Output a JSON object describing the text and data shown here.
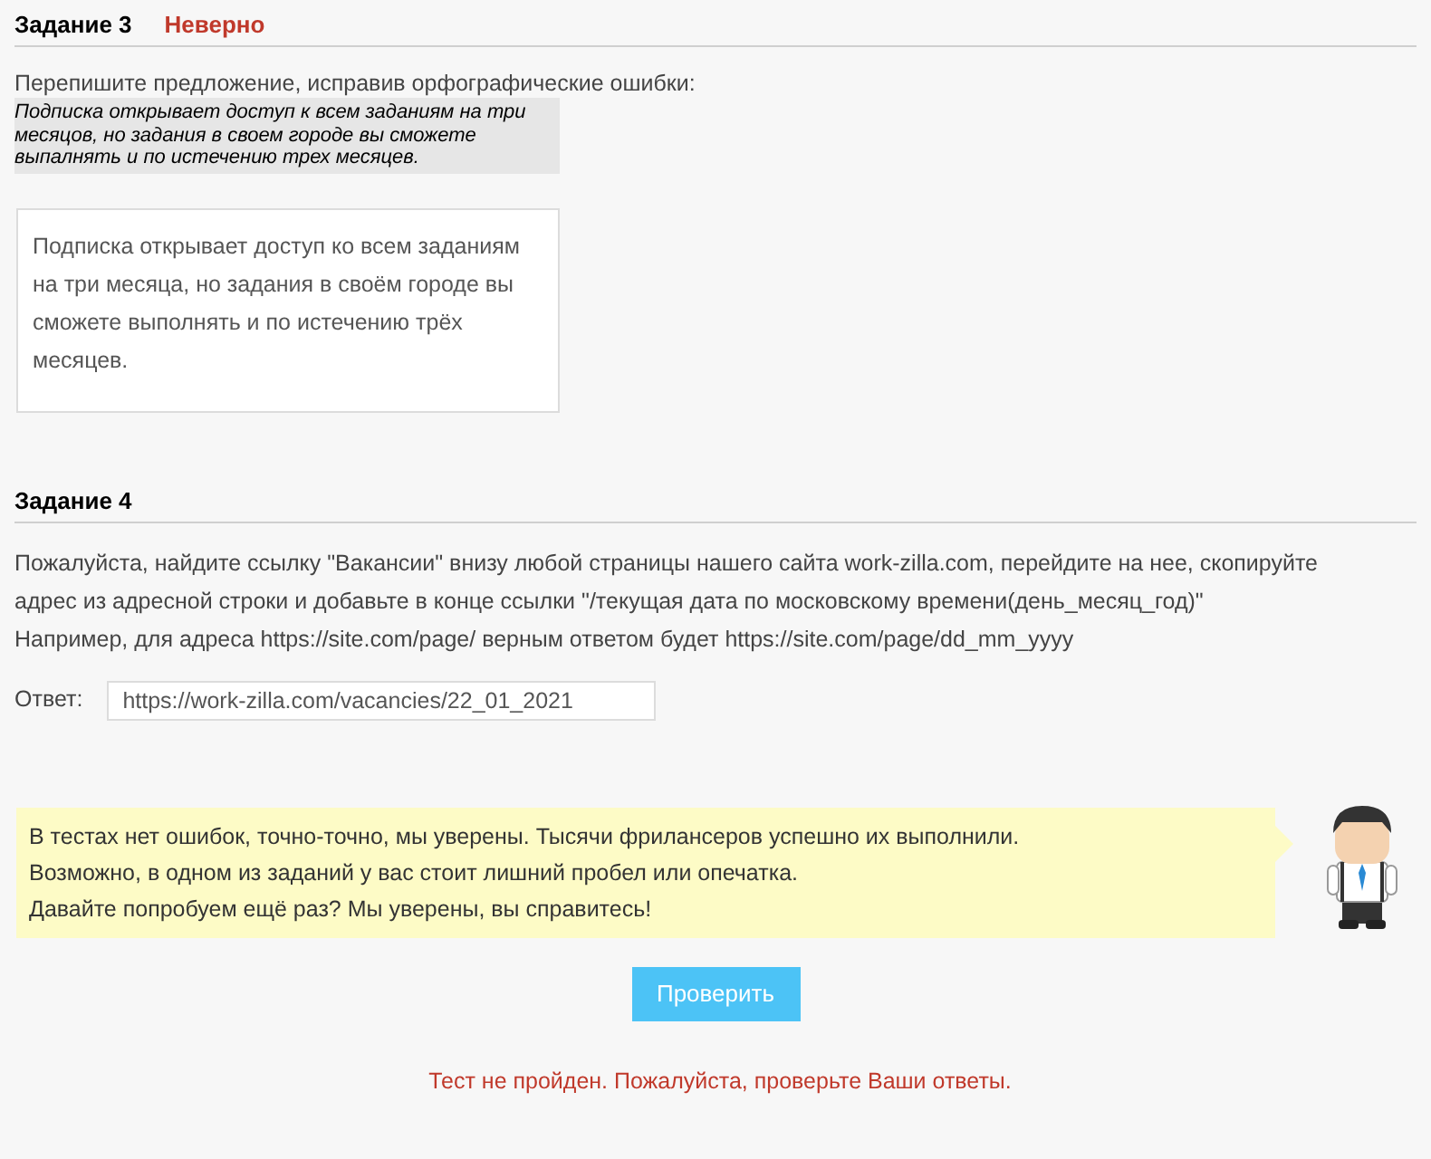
{
  "tasks": [
    {
      "kind": "rewrite",
      "title": "Задание 3",
      "status": "Неверно",
      "prompt": "Перепишите предложение, исправив орфографические ошибки:",
      "source": "Подписка открывает доступ к всем заданиям на три месяцов, но задания в своем городе вы сможете выпалнять и по истечению трех месяцев.",
      "answer": "Подписка открывает доступ ко всем заданиям на три месяца, но задания в своём городе вы сможете выполнять и по истечению трёх месяцев."
    },
    {
      "kind": "link",
      "title": "Задание 4",
      "lines": [
        "Пожалуйста, найдите ссылку \"Вакансии\" внизу любой страницы нашего сайта work-zilla.com, перейдите на нее, скопируйте",
        "адрес из адресной строки и добавьте в конце ссылки \"/текущая дата по московскому времени(день_месяц_год)\"",
        "Например, для адреса https://site.com/page/ верным ответом будет https://site.com/page/dd_mm_yyyy"
      ],
      "answer_label": "Ответ:",
      "answer": "https://work-zilla.com/vacancies/22_01_2021"
    }
  ],
  "notice": {
    "lines": [
      "В тестах нет ошибок, точно-точно, мы уверены. Тысячи фрилансеров успешно их выполнили.",
      "Возможно, в одном из заданий у вас стоит лишний пробел или опечатка.",
      "Давайте попробуем ещё раз? Мы уверены, вы справитесь!"
    ]
  },
  "check_button": "Проверить",
  "result": "Тест не пройден. Пожалуйста, проверьте Ваши ответы."
}
